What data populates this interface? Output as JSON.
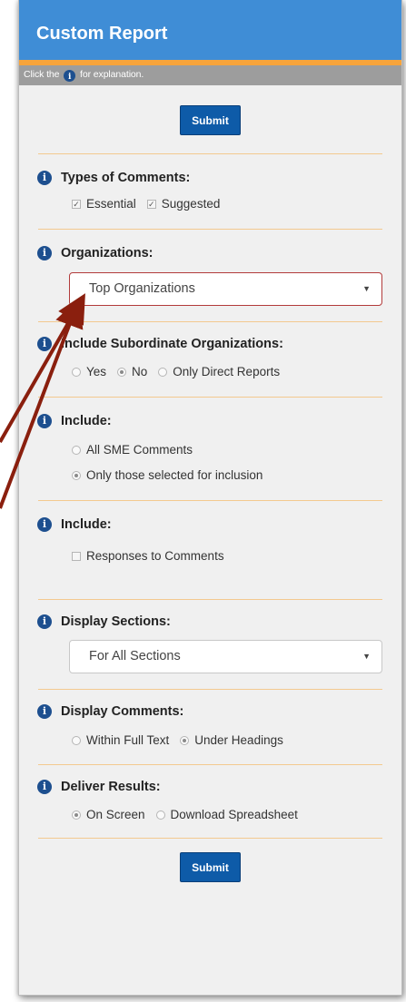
{
  "header": {
    "title": "Custom Report"
  },
  "subheader": {
    "before": "Click the",
    "after": "for explanation."
  },
  "submit_label": "Submit",
  "types": {
    "title": "Types of Comments:",
    "options": [
      "Essential",
      "Suggested"
    ]
  },
  "organizations": {
    "title": "Organizations:",
    "value": "Top Organizations"
  },
  "subordinates": {
    "title": "Include Subordinate Organizations:",
    "options": [
      "Yes",
      "No",
      "Only Direct Reports"
    ],
    "selected": "No"
  },
  "include1": {
    "title": "Include:",
    "options": [
      "All SME Comments",
      "Only those selected for inclusion"
    ],
    "selected": "Only those selected for inclusion"
  },
  "include2": {
    "title": "Include:",
    "options": [
      "Responses to Comments"
    ]
  },
  "display_sections": {
    "title": "Display Sections:",
    "value": "For All Sections"
  },
  "display_comments": {
    "title": "Display Comments:",
    "options": [
      "Within Full Text",
      "Under Headings"
    ],
    "selected": "Under Headings"
  },
  "deliver": {
    "title": "Deliver Results:",
    "options": [
      "On Screen",
      "Download Spreadsheet"
    ],
    "selected": "On Screen"
  },
  "colors": {
    "header_bg": "#3f8dd6",
    "accent": "#f7a43b",
    "button": "#0e5ba8",
    "info_icon": "#1d4f8f",
    "annotation_arrow": "#8a1f0e"
  }
}
